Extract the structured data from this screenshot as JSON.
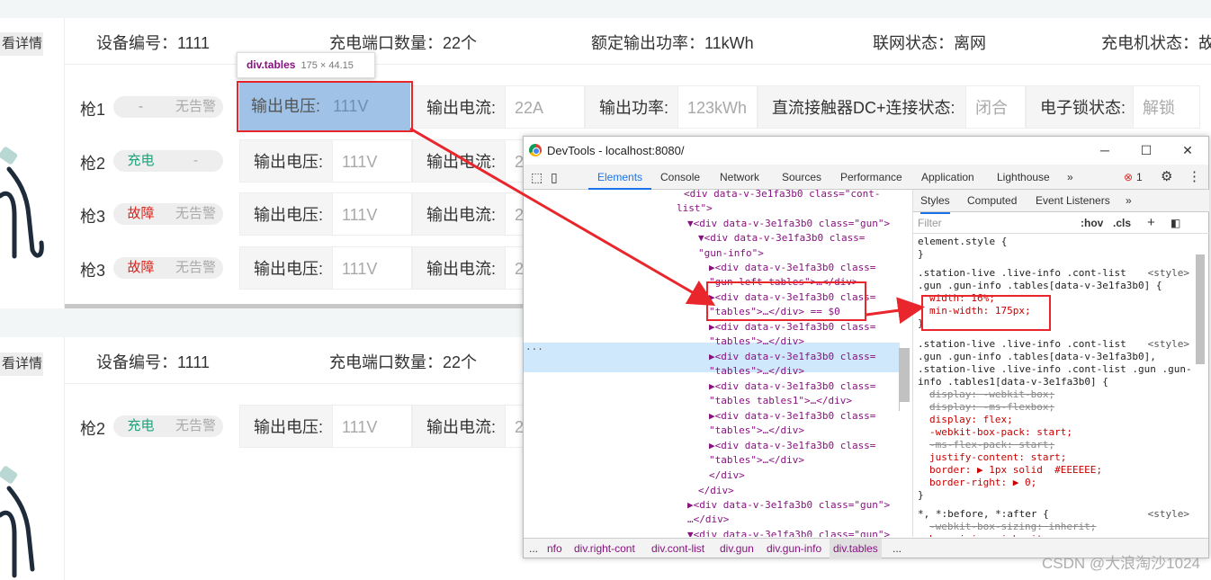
{
  "app": {
    "detail_btn": "看详情",
    "station1": {
      "device_no": "设备编号：1111",
      "port_count": "充电端口数量：22个",
      "rated_power": "额定输出功率：11kWh",
      "network": "联网状态：离网",
      "charger_status": "充电机状态：故"
    },
    "station2": {
      "device_no": "设备编号：1111",
      "port_count": "充电端口数量：22个"
    },
    "guns1": [
      {
        "label": "枪1",
        "s1": "-",
        "s2": "无告警"
      },
      {
        "label": "枪2",
        "s1": "充电",
        "s2": "-"
      },
      {
        "label": "枪3",
        "s1": "故障",
        "s2": "无告警"
      },
      {
        "label": "枪3",
        "s1": "故障",
        "s2": "无告警"
      }
    ],
    "guns2": [
      {
        "label": "枪2",
        "s1": "充电",
        "s2": "无告警"
      }
    ],
    "fields": {
      "voltage_k": "输出电压:",
      "voltage_v": "111V",
      "current_k": "输出电流:",
      "current_v": "22A",
      "current_v_short": "2",
      "power_k": "输出功率:",
      "power_v": "123kWh",
      "contactor_k": "直流接触器DC+连接状态:",
      "contactor_v": "闭合",
      "lock_k": "电子锁状态:",
      "lock_v": "解锁"
    }
  },
  "tooltip": {
    "tag": "div.tables",
    "dims": "175 × 44.15"
  },
  "devtools": {
    "title": "DevTools - localhost:8080/",
    "tabs": [
      "Elements",
      "Console",
      "Network",
      "Sources",
      "Performance",
      "Application",
      "Lighthouse",
      "»"
    ],
    "error_count": "1",
    "styles_tabs": [
      "Styles",
      "Computed",
      "Event Listeners",
      "»"
    ],
    "filter_placeholder": "Filter",
    "hov": ":hov",
    "cls": ".cls",
    "dom_lines": [
      "<div data-v-3e1fa3b0 class=\"cont-",
      "list\">",
      "▼<div data-v-3e1fa3b0 class=\"gun\">",
      "▼<div data-v-3e1fa3b0 class=",
      "\"gun-info\">",
      "▶<div data-v-3e1fa3b0 class=",
      "\"gun-left tables\">…</div>",
      "▶<div data-v-3e1fa3b0 class=",
      "\"tables\">…</div> == $0",
      "▶<div data-v-3e1fa3b0 class=",
      "\"tables\">…</div>",
      "▶<div data-v-3e1fa3b0 class=",
      "\"tables\">…</div>",
      "▶<div data-v-3e1fa3b0 class=",
      "\"tables tables1\">…</div>",
      "▶<div data-v-3e1fa3b0 class=",
      "\"tables\">…</div>",
      "▶<div data-v-3e1fa3b0 class=",
      "\"tables\">…</div>",
      "</div>",
      "</div>",
      "▶<div data-v-3e1fa3b0 class=\"gun\">",
      "…</div>",
      "▼<div data-v-3e1fa3b0 class=\"gun\">"
    ],
    "style_rules": [
      "element.style {",
      "}",
      ".station-live .live-info .cont-list",
      ".gun .gun-info .tables[data-v-3e1fa3b0] {",
      "width: 16%;",
      "min-width: 175px;",
      "}",
      ".station-live .live-info .cont-list",
      ".gun .gun-info .tables[data-v-3e1fa3b0],",
      ".station-live .live-info .cont-list .gun .gun-",
      "info .tables1[data-v-3e1fa3b0] {",
      "display: -webkit-box;",
      "display: -ms-flexbox;",
      "display: flex;",
      "-webkit-box-pack: start;",
      "-ms-flex-pack: start;",
      "justify-content: start;",
      "border: ▶ 1px solid  #EEEEEE;",
      "border-right: ▶ 0;",
      "}",
      "*, *:before, *:after {",
      "-webkit-box-sizing: inherit;",
      "box-sizing: inherit;"
    ],
    "style_src": "<style>",
    "breadcrumbs": [
      "...",
      "nfo",
      "div.right-cont",
      "div.cont-list",
      "div.gun",
      "div.gun-info",
      "div.tables",
      "..."
    ]
  },
  "watermark": "CSDN @大浪淘沙1024"
}
